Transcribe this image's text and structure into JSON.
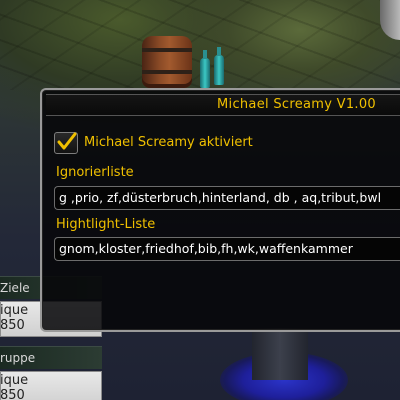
{
  "addon": {
    "title": "Michael Screamy V1.00",
    "enabled_label": "Michael Screamy aktiviert",
    "enabled_checked": true,
    "ignore_label": "Ignorierliste",
    "ignore_value": "g ,prio, zf,düsterbruch,hinterland, db , aq,tribut,bwl",
    "highlight_label": "Hightlight-Liste",
    "highlight_value": "gnom,kloster,friedhof,bib,fh,wk,waffenkammer"
  },
  "side_panel": {
    "header1": "Ziele",
    "card1_line1": "ique",
    "card1_line2": "850",
    "header2": "ruppe",
    "card2_line1": "ique",
    "card2_line2": "850"
  },
  "colors": {
    "accent": "#f0c000",
    "field_text": "#ffffff",
    "window_bg": "#060608"
  },
  "icons": {
    "checkbox": "check-icon"
  }
}
